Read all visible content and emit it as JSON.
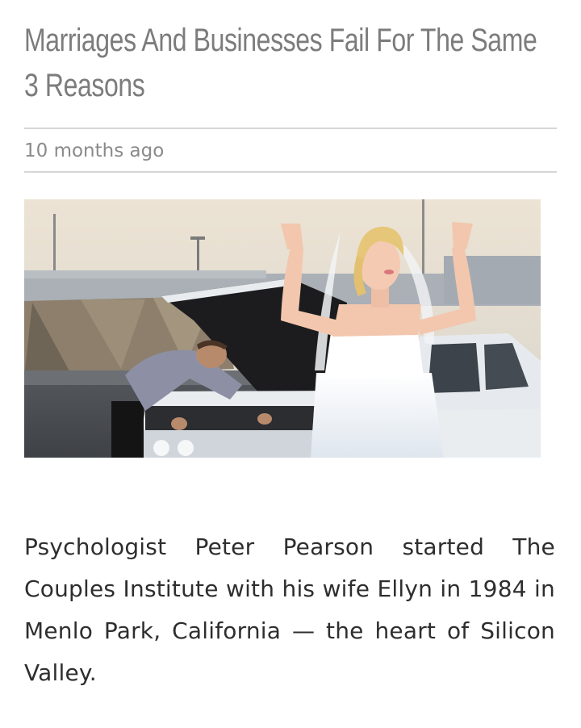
{
  "article": {
    "title": "Marriages And Businesses Fail For The Same 3 Reasons",
    "timestamp": "10 months ago",
    "body": "Psychologist Peter Pearson started The Couples Institute with his wife Ellyn in 1984 in Menlo Park, California — the heart of Silicon Valley."
  },
  "colors": {
    "title": "#7c7c7c",
    "timestamp": "#8a8a8a",
    "body": "#2e2e2e",
    "divider": "#d6d6d6"
  }
}
